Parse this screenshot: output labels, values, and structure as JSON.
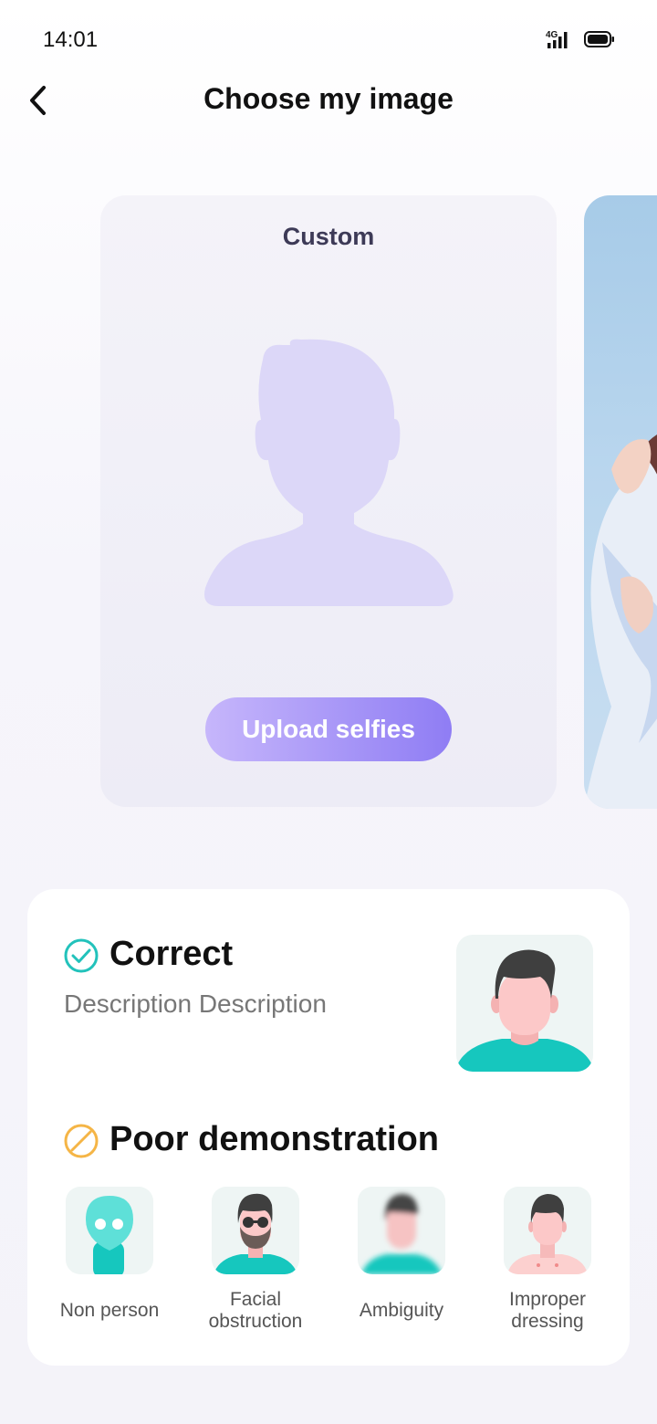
{
  "status_bar": {
    "time": "14:01",
    "network": "4G",
    "signal_icon": "signal-icon",
    "battery_icon": "battery-icon"
  },
  "header": {
    "title": "Choose my image",
    "back_icon": "chevron-left-icon"
  },
  "custom_card": {
    "title": "Custom",
    "placeholder_icon": "person-silhouette-icon",
    "upload_label": "Upload selfies"
  },
  "guide": {
    "correct": {
      "title": "Correct",
      "description": "Description Description",
      "icon": "check-circle-icon"
    },
    "poor": {
      "title": "Poor demonstration",
      "icon": "prohibited-icon",
      "examples": [
        {
          "label": "Non person",
          "icon": "alien-icon"
        },
        {
          "label": "Facial obstruction",
          "icon": "sunglasses-beard-icon"
        },
        {
          "label": "Ambiguity",
          "icon": "blurred-person-icon"
        },
        {
          "label": "Improper dressing",
          "icon": "shirtless-person-icon"
        }
      ]
    }
  },
  "colors": {
    "accent_start": "#c6b6fb",
    "accent_end": "#8f7df4",
    "teal": "#16c7be",
    "warning": "#f5b546"
  }
}
